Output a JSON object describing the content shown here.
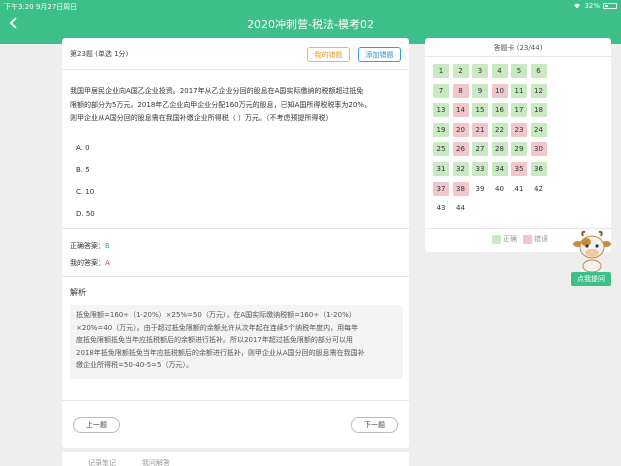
{
  "statusbar": {
    "time_date": "下午3:20   9月27日周日",
    "battery": "32%"
  },
  "header": {
    "title": "2020冲刺营-税法-模考02"
  },
  "question": {
    "header": "第23题 (单选  1分)",
    "my_wrong_btn": "我的错题",
    "add_wrong_btn": "添加错题",
    "lines": [
      "我国甲居民企业向A国乙企业投资。2017年从乙企业分回的股息在A国实际缴纳的税额超过抵免",
      "限额的部分为5万元。2018年乙企业向甲企业分配160万元的股息，已知A国所得税税率为20%，",
      "则甲企业从A国分回的股息需在我国补缴企业所得税（      ）万元。（不考虑预提所得税）"
    ],
    "options": [
      "A. 0",
      "B. 5",
      "C. 10",
      "D. 50"
    ],
    "correct_label": "正确答案：",
    "correct_value": "B",
    "my_label": "我的答案：",
    "my_value": "A",
    "explain_title": "解析",
    "explain_lines": [
      "抵免限额=160÷（1-20%）×25%=50（万元），在A国实际缴纳税额=160÷（1-20%）",
      "×20%=40（万元）。由于超过抵免限额的余额允许从次年起在连续5个纳税年度内，用每年",
      "度抵免限额抵免当年应抵税额后的余额进行抵补。所以2017年超过抵免限额的部分可以用",
      "2018年抵免限额抵免当年应抵税额后的余额进行抵补，则甲企业从A国分回的股息需在我国补",
      "缴企业所得税=50-40-5=5（万元）。"
    ],
    "prev_btn": "上一题",
    "next_btn": "下一题"
  },
  "bottom_tabs": [
    "记录笔记",
    "我问解答"
  ],
  "answer_sheet": {
    "title": "答题卡  (23/44)",
    "items": [
      {
        "n": "1",
        "s": "c"
      },
      {
        "n": "2",
        "s": "c"
      },
      {
        "n": "3",
        "s": "c"
      },
      {
        "n": "4",
        "s": "c"
      },
      {
        "n": "5",
        "s": "c"
      },
      {
        "n": "6",
        "s": "c"
      },
      {
        "n": "7",
        "s": "c"
      },
      {
        "n": "8",
        "s": "w"
      },
      {
        "n": "9",
        "s": "c"
      },
      {
        "n": "10",
        "s": "w"
      },
      {
        "n": "11",
        "s": "c"
      },
      {
        "n": "12",
        "s": "c"
      },
      {
        "n": "13",
        "s": "c"
      },
      {
        "n": "14",
        "s": "w"
      },
      {
        "n": "15",
        "s": "c"
      },
      {
        "n": "16",
        "s": "c"
      },
      {
        "n": "17",
        "s": "c"
      },
      {
        "n": "18",
        "s": "c"
      },
      {
        "n": "19",
        "s": "c"
      },
      {
        "n": "20",
        "s": "w"
      },
      {
        "n": "21",
        "s": "w"
      },
      {
        "n": "22",
        "s": "c"
      },
      {
        "n": "23",
        "s": "w"
      },
      {
        "n": "24",
        "s": "c"
      },
      {
        "n": "25",
        "s": "c"
      },
      {
        "n": "26",
        "s": "w"
      },
      {
        "n": "27",
        "s": "c"
      },
      {
        "n": "28",
        "s": "c"
      },
      {
        "n": "29",
        "s": "c"
      },
      {
        "n": "30",
        "s": "w"
      },
      {
        "n": "31",
        "s": "c"
      },
      {
        "n": "32",
        "s": "c"
      },
      {
        "n": "33",
        "s": "c"
      },
      {
        "n": "34",
        "s": "c"
      },
      {
        "n": "35",
        "s": "w"
      },
      {
        "n": "36",
        "s": "c"
      },
      {
        "n": "37",
        "s": "w"
      },
      {
        "n": "38",
        "s": "w"
      },
      {
        "n": "39",
        "s": "n"
      },
      {
        "n": "40",
        "s": "n"
      },
      {
        "n": "41",
        "s": "n"
      },
      {
        "n": "42",
        "s": "n"
      },
      {
        "n": "43",
        "s": "n"
      },
      {
        "n": "44",
        "s": "n"
      }
    ],
    "legend_correct": "正确",
    "legend_wrong": "错误"
  },
  "helper": {
    "ask_label": "点我提问",
    "mascot_icon": "cow-mascot-icon"
  },
  "colors": {
    "brand": "#3dbf8a",
    "correct_cell": "#c9e9c3",
    "wrong_cell": "#f2c7cc"
  }
}
